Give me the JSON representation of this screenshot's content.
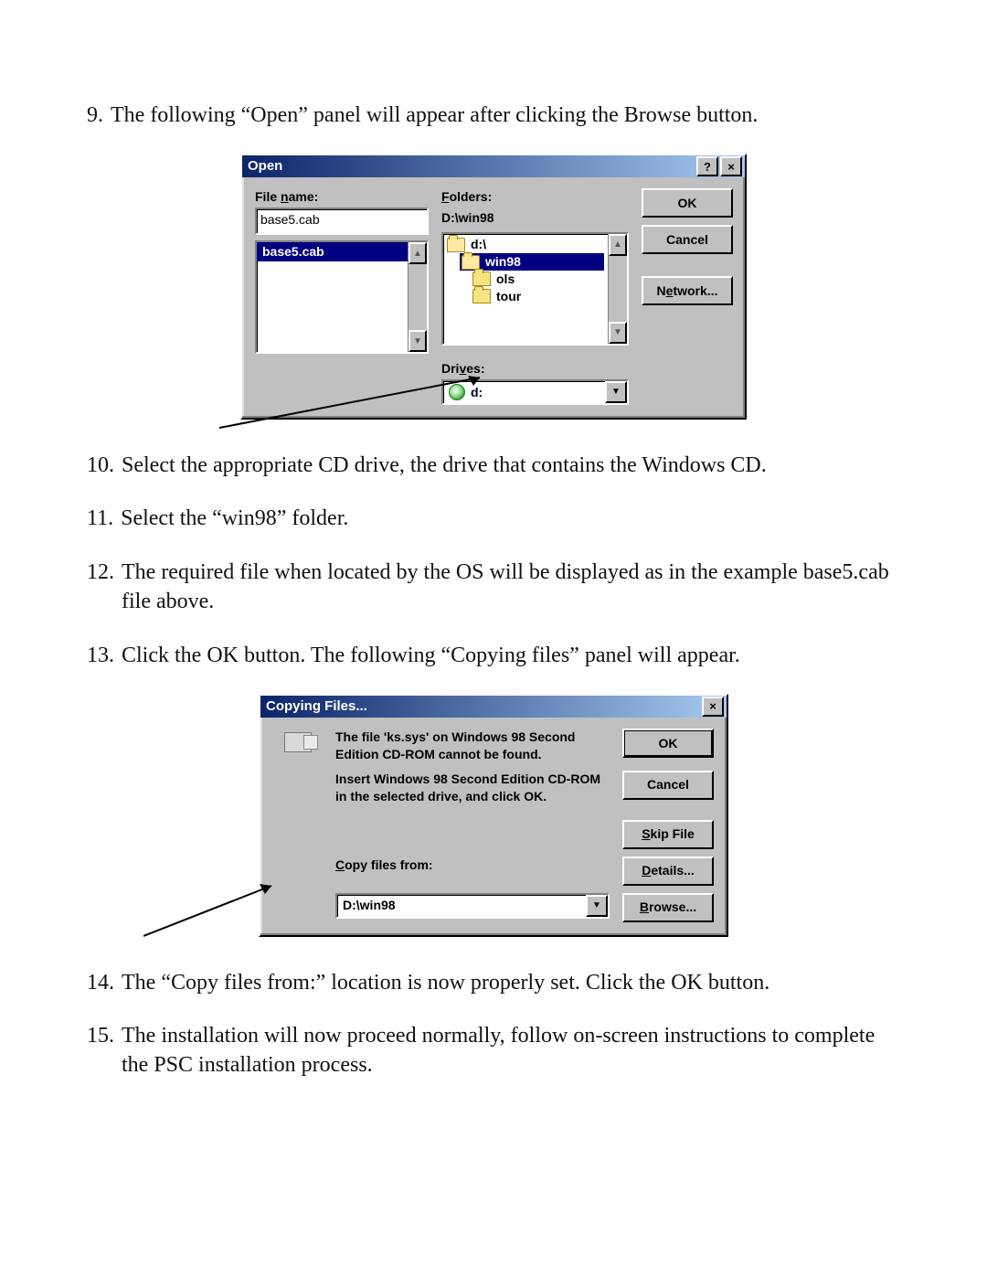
{
  "step9": {
    "num": "9.",
    "text": "The following “Open” panel will appear after clicking the Browse button."
  },
  "step10": {
    "num": "10.",
    "text": "Select the appropriate CD drive, the drive that contains the Windows CD."
  },
  "step11": {
    "num": "11.",
    "text": "Select the “win98” folder."
  },
  "step12": {
    "num": "12.",
    "text": "The required file when located by the OS will be displayed as in the example base5.cab file above."
  },
  "step13": {
    "num": "13.",
    "text": "Click the OK button. The following “Copying files” panel will appear."
  },
  "step14": {
    "num": "14.",
    "text": "The “Copy files from:” location is now properly set. Click the OK button."
  },
  "step15": {
    "num": "15.",
    "text": "The installation will now proceed normally, follow on-screen instructions to complete the PSC installation process."
  },
  "open_dialog": {
    "title": "Open",
    "file_name_label": "File name:",
    "file_name_value": "base5.cab",
    "file_list_item": "base5.cab",
    "folders_label": "Folders:",
    "folders_path": "D:\\win98",
    "folder_tree": {
      "root": "d:\\",
      "selected": "win98",
      "children": [
        "ols",
        "tour"
      ]
    },
    "drives_label": "Drives:",
    "drives_value": "d:",
    "buttons": {
      "ok": "OK",
      "cancel": "Cancel",
      "network": "Network..."
    },
    "access": {
      "file": "n",
      "folders": "F",
      "drives": "v",
      "network": "e"
    }
  },
  "copying_dialog": {
    "title": "Copying Files...",
    "msg1": "The file 'ks.sys' on Windows 98 Second Edition CD-ROM cannot be found.",
    "msg2": "Insert Windows 98 Second Edition CD-ROM in the selected drive, and click OK.",
    "copy_from_label": "Copy files from:",
    "copy_from_value": "D:\\win98",
    "buttons": {
      "ok": "OK",
      "cancel": "Cancel",
      "skip": "Skip File",
      "details": "Details...",
      "browse": "Browse..."
    },
    "access": {
      "copy": "C",
      "skip": "S",
      "details": "D",
      "browse": "B"
    }
  }
}
